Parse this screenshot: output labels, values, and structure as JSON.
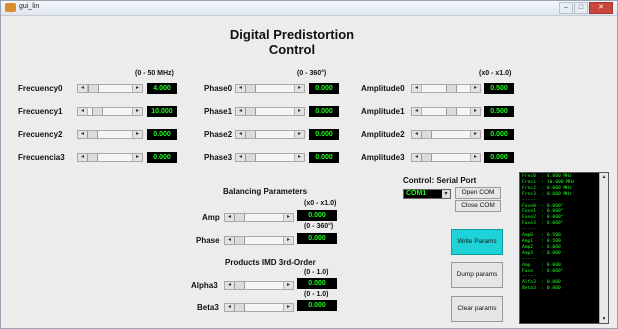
{
  "window": {
    "title": "gui_lin"
  },
  "heading": {
    "line1": "Digital Predistortion",
    "line2": "Control"
  },
  "ranges": {
    "frequency": "(0 - 50 MHz)",
    "phase": "(0 - 360°)",
    "amplitude": "(x0 - x1.0)",
    "amp_bal": "(x0 - x1.0)",
    "phase_bal": "(0 - 360°)",
    "alpha3": "(0 - 1.0)",
    "beta3": "(0 - 1.0)"
  },
  "frequency_rows": [
    {
      "label": "Frecuency0",
      "value": "4.000"
    },
    {
      "label": "Frecuency1",
      "value": "10.000"
    },
    {
      "label": "Frecuency2",
      "value": "0.000"
    },
    {
      "label": "Frecuencia3",
      "value": "0.000"
    }
  ],
  "phase_rows": [
    {
      "label": "Phase0",
      "value": "0.000"
    },
    {
      "label": "Phase1",
      "value": "0.000"
    },
    {
      "label": "Phase2",
      "value": "0.000"
    },
    {
      "label": "Phase3",
      "value": "0.000"
    }
  ],
  "amplitude_rows": [
    {
      "label": "Amplitude0",
      "value": "0.500"
    },
    {
      "label": "Amplitude1",
      "value": "0.500"
    },
    {
      "label": "Amplitude2",
      "value": "0.000"
    },
    {
      "label": "Amplitude3",
      "value": "0.000"
    }
  ],
  "balancing": {
    "title": "Balancing Parameters",
    "amp_label": "Amp",
    "amp_value": "0.000",
    "phase_label": "Phase",
    "phase_value": "0.000"
  },
  "imd": {
    "title": "Products IMD 3rd-Order",
    "alpha_label": "Alpha3",
    "alpha_value": "0.000",
    "beta_label": "Beta3",
    "beta_value": "0.000"
  },
  "serial": {
    "title": "Control: Serial Port",
    "port": "COM1",
    "open_label": "Open COM",
    "close_label": "Close COM"
  },
  "buttons": {
    "write": "Write Params",
    "dump": "Dump params",
    "clear": "Clear params"
  },
  "console_lines": [
    "Frec0  : 4.000 MHz",
    "Frec1  : 10.000 MHz",
    "Frec2  : 0.000 MHz",
    "Frec3  : 0.000 MHz",
    "-----",
    "Fase0  : 0.000°",
    "Fase1  : 0.000°",
    "Fase2  : 0.000°",
    "Fase3  : 0.000°",
    "-----",
    "Amp0   : 0.500",
    "Amp1   : 0.500",
    "Amp2   : 0.000",
    "Amp3   : 0.000",
    "-----",
    "Amp    : 0.000",
    "Fase   : 0.000°",
    "-----",
    "Alfa3  : 0.000",
    "Beta3  : 0.000"
  ],
  "colors": {
    "display_bg": "#000000",
    "display_fg": "#1aff1a",
    "accent_button": "#1fd2d8"
  }
}
